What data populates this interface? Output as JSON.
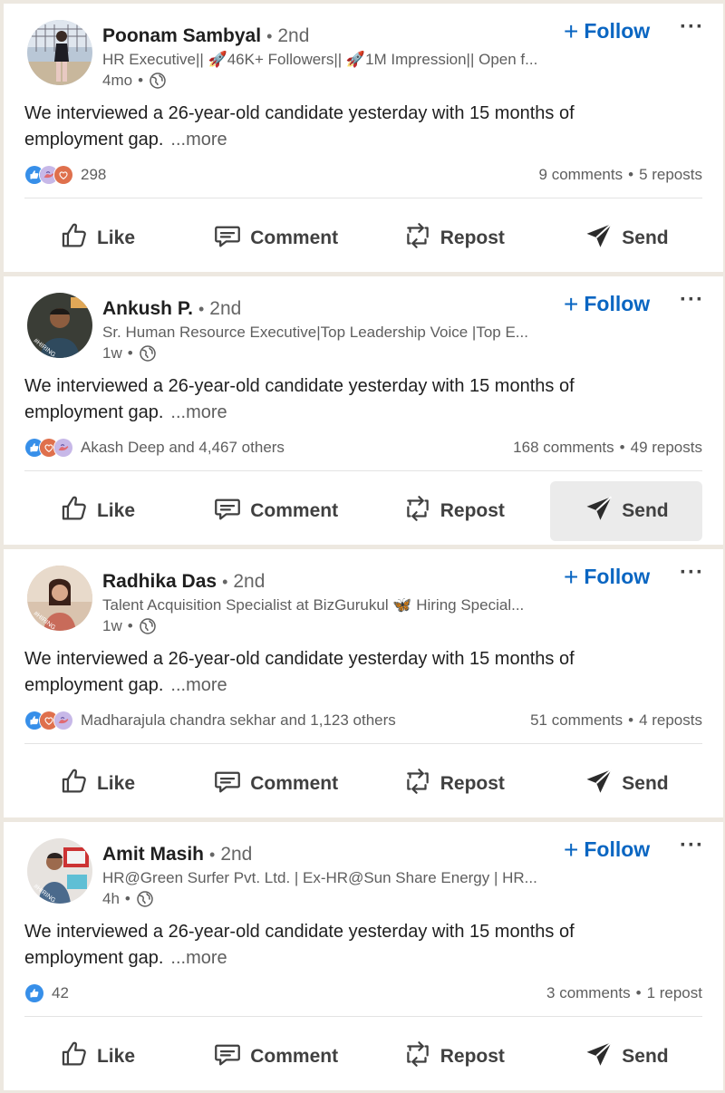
{
  "posts": [
    {
      "name": "Poonam Sambyal",
      "separator": "•",
      "degree": "2nd",
      "headline": "HR Executive|| 🚀46K+ Followers|| 🚀1M Impression|| Open f...",
      "time": "4mo",
      "time_sep": "•",
      "follow_label": "Follow",
      "text": "We interviewed a 26-year-old candidate yesterday with 15 months of employment gap.",
      "see_more": "...more",
      "reactions_label": "298",
      "comments": "9 comments",
      "count_sep": "•",
      "reposts": "5 reposts",
      "actions": {
        "like": "Like",
        "comment": "Comment",
        "repost": "Repost",
        "send": "Send"
      },
      "reaction_icons": [
        "like-reaction-icon",
        "support-reaction-icon",
        "love-reaction-icon"
      ]
    },
    {
      "name": "Ankush P.",
      "separator": "•",
      "degree": "2nd",
      "headline": "Sr. Human Resource Executive|Top Leadership Voice |Top E...",
      "time": "1w",
      "time_sep": "•",
      "follow_label": "Follow",
      "text": "We interviewed a 26-year-old candidate yesterday with 15 months of employment gap.",
      "see_more": "...more",
      "reactions_label": "Akash Deep and 4,467 others",
      "comments": "168 comments",
      "count_sep": "•",
      "reposts": "49 reposts",
      "actions": {
        "like": "Like",
        "comment": "Comment",
        "repost": "Repost",
        "send": "Send"
      },
      "reaction_icons": [
        "like-reaction-icon",
        "love-reaction-icon",
        "support-reaction-icon"
      ],
      "hovered_action": "send"
    },
    {
      "name": "Radhika Das",
      "separator": "•",
      "degree": "2nd",
      "headline": "Talent Acquisition Specialist at BizGurukul 🦋 Hiring Special...",
      "time": "1w",
      "time_sep": "•",
      "follow_label": "Follow",
      "text": "We interviewed a 26-year-old candidate yesterday with 15 months of employment gap.",
      "see_more": "...more",
      "reactions_label": "Madharajula chandra sekhar and 1,123 others",
      "comments": "51 comments",
      "count_sep": "•",
      "reposts": "4 reposts",
      "actions": {
        "like": "Like",
        "comment": "Comment",
        "repost": "Repost",
        "send": "Send"
      },
      "reaction_icons": [
        "like-reaction-icon",
        "love-reaction-icon",
        "support-reaction-icon"
      ]
    },
    {
      "name": "Amit Masih",
      "separator": "•",
      "degree": "2nd",
      "headline": "HR@Green Surfer Pvt. Ltd. | Ex-HR@Sun Share Energy | HR...",
      "time": "4h",
      "time_sep": "•",
      "follow_label": "Follow",
      "text": "We interviewed a 26-year-old candidate yesterday with 15 months of employment gap.",
      "see_more": "...more",
      "reactions_label": "42",
      "comments": "3 comments",
      "count_sep": "•",
      "reposts": "1 repost",
      "actions": {
        "like": "Like",
        "comment": "Comment",
        "repost": "Repost",
        "send": "Send"
      },
      "reaction_icons": [
        "like-reaction-icon"
      ]
    }
  ],
  "menu_glyph": "···",
  "hiring_badge": "#HIRING",
  "colors": {
    "follow_blue": "#0a66c2",
    "like_blue": "#378fe9",
    "love_red": "#df704d",
    "hiring_purple": "#7b3fc4",
    "background": "#ede8e0"
  }
}
